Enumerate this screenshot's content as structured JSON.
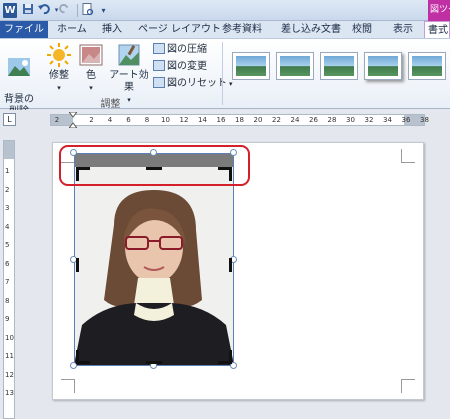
{
  "title_bar": {
    "app_icon_text": "W",
    "context_tab_group": "図ツール"
  },
  "tabs": [
    "ファイル",
    "ホーム",
    "挿入",
    "ページ レイアウト",
    "参考資料",
    "差し込み文書",
    "校閲",
    "表示",
    "書式"
  ],
  "ribbon": {
    "buttons": {
      "remove_background": "背景の\n削除",
      "corrections": "修整",
      "color": "色",
      "artistic_effects": "アート効果"
    },
    "small_buttons": {
      "compress": "図の圧縮",
      "change_picture": "図の変更",
      "reset_picture": "図のリセット"
    },
    "group_label": "調整"
  },
  "ruler": {
    "corner_glyph": "L",
    "h_ticks": [
      "2",
      "2",
      "4",
      "6",
      "8",
      "10",
      "12",
      "14",
      "16",
      "18",
      "20",
      "22",
      "24",
      "26",
      "28",
      "30",
      "32",
      "34",
      "36",
      "38"
    ],
    "v_ticks": [
      "1",
      "2",
      "3",
      "4",
      "5",
      "6",
      "7",
      "8",
      "9",
      "10",
      "11",
      "12",
      "13"
    ]
  },
  "colors": {
    "file_tab": "#2a5aa8",
    "context_tab": "#c02fa3",
    "highlight": "#d4202a",
    "crop_bar": "#7b7b7b"
  },
  "icons": [
    "undo-icon",
    "redo-icon",
    "save-icon",
    "print-preview-icon",
    "sun-icon",
    "palette-icon",
    "brush-icon"
  ]
}
